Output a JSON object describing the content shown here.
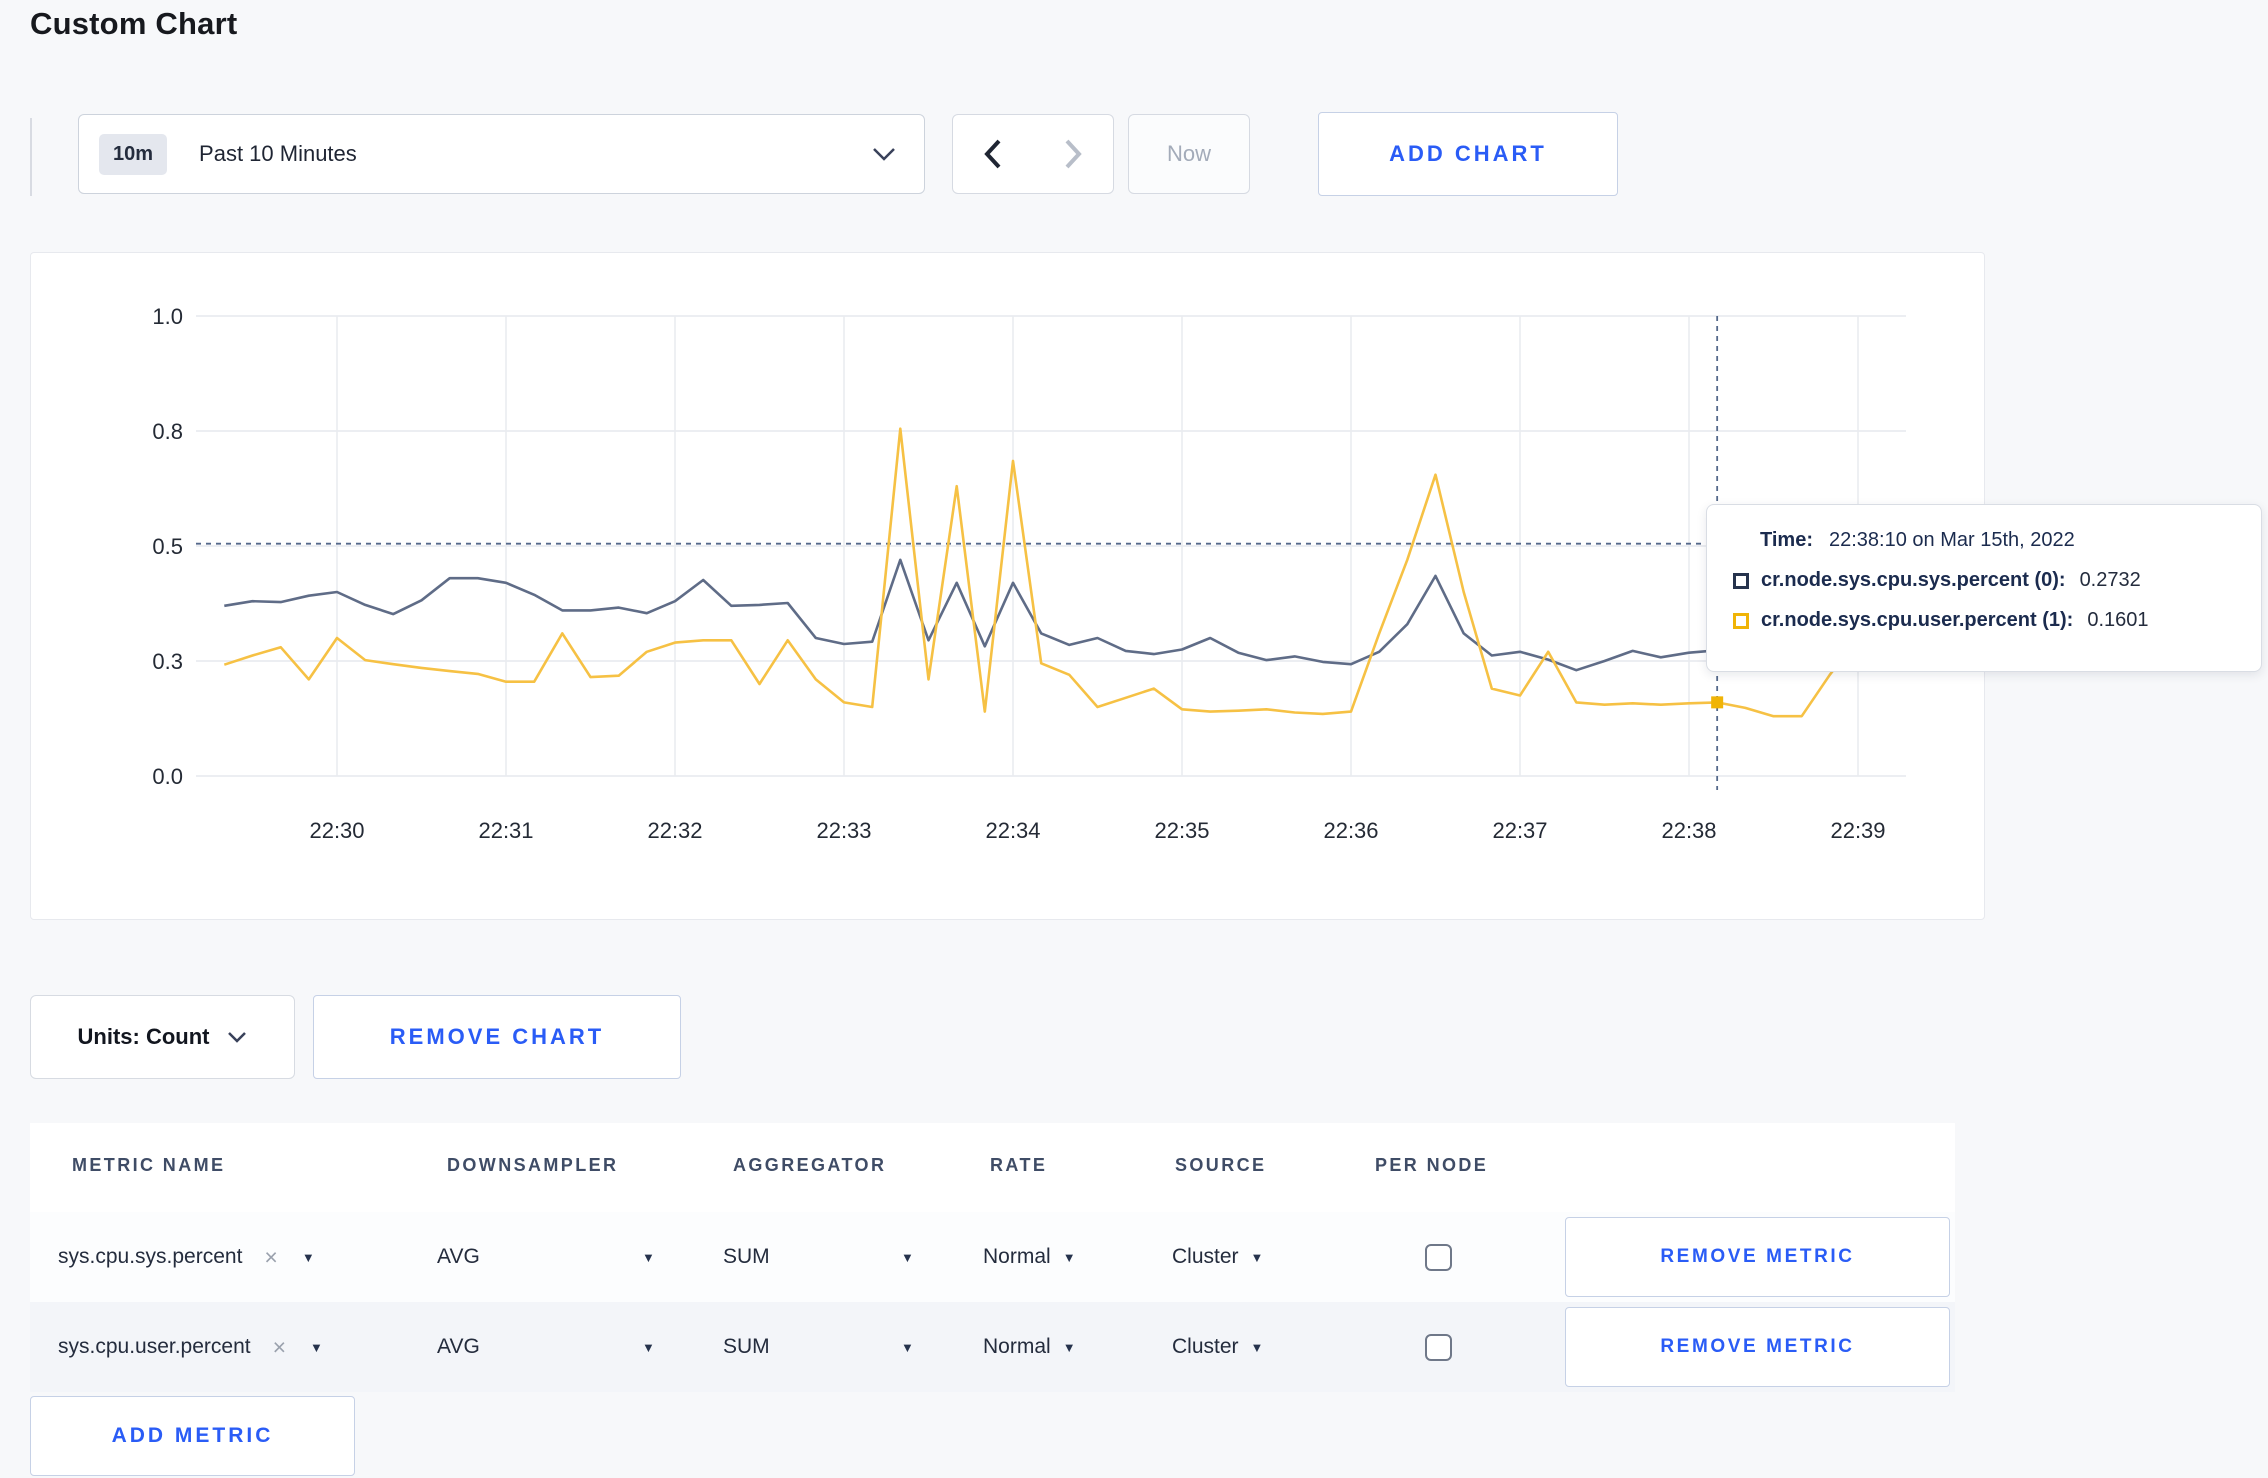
{
  "page": {
    "title": "Custom Chart"
  },
  "toolbar": {
    "range_badge": "10m",
    "range_label": "Past 10 Minutes",
    "now_label": "Now",
    "add_chart_label": "ADD CHART"
  },
  "chart_data": {
    "type": "line",
    "title": "",
    "xlabel": "",
    "ylabel": "",
    "ylim": [
      0,
      1
    ],
    "grid": true,
    "x_start": "22:29:20",
    "x_interval_seconds": 10,
    "x_tick_labels": [
      "22:30",
      "22:31",
      "22:32",
      "22:33",
      "22:34",
      "22:35",
      "22:36",
      "22:37",
      "22:38",
      "22:39"
    ],
    "y_tick_labels": [
      "0.0",
      "0.3",
      "0.5",
      "0.8",
      "1.0"
    ],
    "y_tick_values": [
      0,
      0.25,
      0.5,
      0.75,
      1.0
    ],
    "series": [
      {
        "name": "cr.node.sys.cpu.sys.percent (0)",
        "color": "#5f6c87",
        "swatch": "#26334d",
        "values": [
          0.37,
          0.38,
          0.378,
          0.392,
          0.4,
          0.372,
          0.352,
          0.382,
          0.43,
          0.43,
          0.42,
          0.394,
          0.36,
          0.36,
          0.366,
          0.354,
          0.38,
          0.426,
          0.37,
          0.372,
          0.376,
          0.3,
          0.287,
          0.292,
          0.47,
          0.295,
          0.42,
          0.282,
          0.42,
          0.31,
          0.285,
          0.3,
          0.272,
          0.265,
          0.275,
          0.3,
          0.268,
          0.252,
          0.26,
          0.248,
          0.243,
          0.27,
          0.33,
          0.435,
          0.31,
          0.262,
          0.27,
          0.253,
          0.23,
          0.25,
          0.272,
          0.258,
          0.268,
          0.2732,
          0.25,
          0.242,
          0.252,
          0.262,
          0.272,
          0.285
        ]
      },
      {
        "name": "cr.node.sys.cpu.user.percent (1)",
        "color": "#f6c144",
        "swatch": "#f0b406",
        "values": [
          0.242,
          0.262,
          0.28,
          0.21,
          0.3,
          0.252,
          0.243,
          0.235,
          0.228,
          0.222,
          0.205,
          0.205,
          0.31,
          0.215,
          0.218,
          0.27,
          0.29,
          0.295,
          0.295,
          0.2,
          0.295,
          0.21,
          0.16,
          0.15,
          0.755,
          0.21,
          0.63,
          0.14,
          0.685,
          0.245,
          0.22,
          0.15,
          0.17,
          0.19,
          0.145,
          0.14,
          0.142,
          0.145,
          0.138,
          0.135,
          0.14,
          0.31,
          0.47,
          0.655,
          0.4,
          0.19,
          0.175,
          0.27,
          0.16,
          0.155,
          0.158,
          0.155,
          0.158,
          0.1601,
          0.148,
          0.13,
          0.13,
          0.22,
          0.3,
          0.262
        ]
      }
    ],
    "hover": {
      "index": 53,
      "crosshair_y_value": 0.505,
      "time_label": "Time:",
      "time_value": "22:38:10 on Mar 15th, 2022",
      "values_text": [
        "0.2732",
        "0.1601"
      ]
    },
    "legend_position": "tooltip"
  },
  "controls": {
    "units_label": "Units: Count",
    "remove_chart_label": "REMOVE CHART",
    "add_metric_label": "ADD METRIC",
    "remove_metric_label": "REMOVE METRIC"
  },
  "table": {
    "headers": [
      "METRIC NAME",
      "DOWNSAMPLER",
      "AGGREGATOR",
      "RATE",
      "SOURCE",
      "PER NODE"
    ],
    "rows": [
      {
        "metric": "sys.cpu.sys.percent",
        "downsampler": "AVG",
        "aggregator": "SUM",
        "rate": "Normal",
        "source": "Cluster",
        "per_node_checked": false
      },
      {
        "metric": "sys.cpu.user.percent",
        "downsampler": "AVG",
        "aggregator": "SUM",
        "rate": "Normal",
        "source": "Cluster",
        "per_node_checked": false
      }
    ]
  }
}
